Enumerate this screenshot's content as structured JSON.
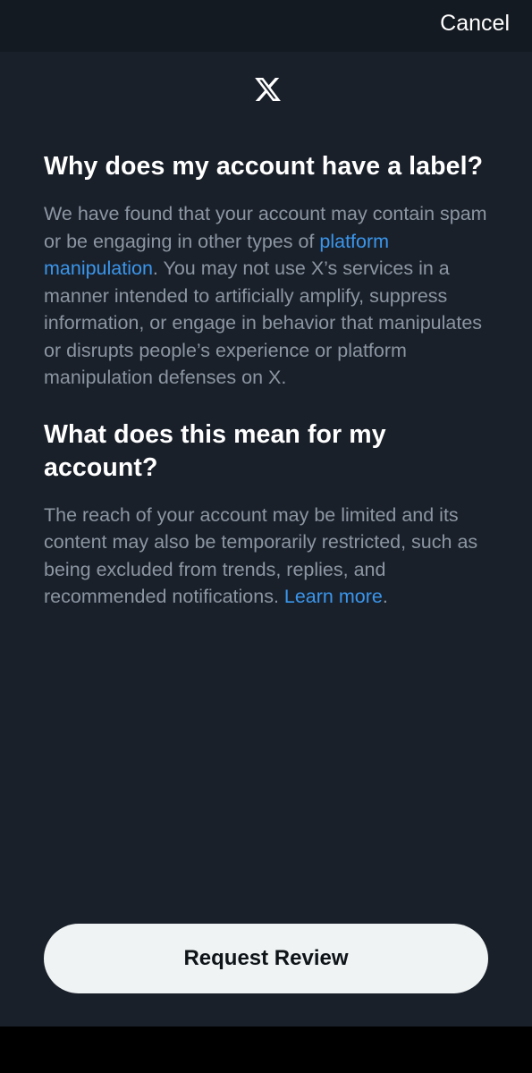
{
  "header": {
    "cancel_label": "Cancel"
  },
  "logo": {
    "icon": "x-logo-icon"
  },
  "section1": {
    "heading": "Why does my account have a label?",
    "text_before_link": "We have found that your account may contain spam or be engaging in other types of ",
    "link_text": "platform manipulation",
    "text_after_link": ". You may not use X’s services in a manner intended to artificially amplify, suppress information, or engage in behavior that manipulates or disrupts people’s experience or platform manipulation defenses on X."
  },
  "section2": {
    "heading": "What does this mean for my account?",
    "text_before_link": "The reach of your account may be limited and its content may also be temporarily restricted, such as being excluded from trends, replies, and recommended notifications. ",
    "link_text": "Learn more",
    "text_after_link": "."
  },
  "footer": {
    "request_review_label": "Request Review"
  },
  "colors": {
    "background": "#1a202a",
    "header_background": "#141a21",
    "body_text": "#8b96a2",
    "link": "#3a96ec",
    "button_background": "#eff3f4"
  }
}
